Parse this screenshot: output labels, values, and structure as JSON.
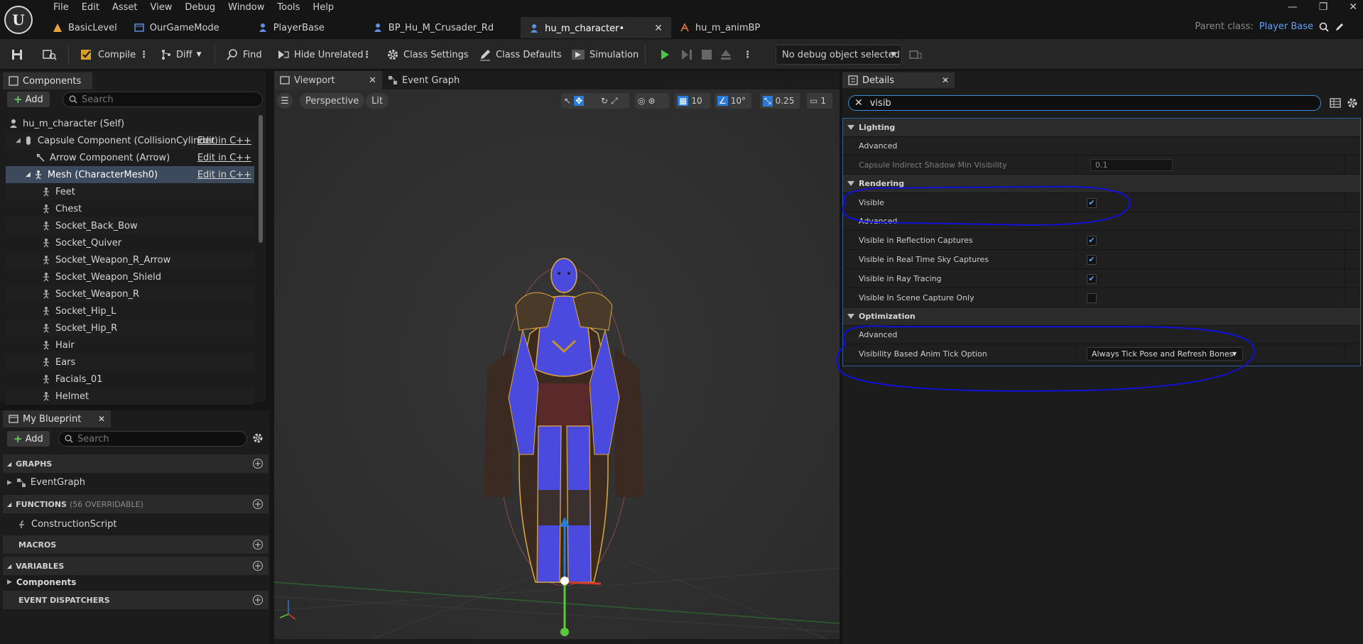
{
  "menu": [
    "File",
    "Edit",
    "Asset",
    "View",
    "Debug",
    "Window",
    "Tools",
    "Help"
  ],
  "doc_tabs": [
    {
      "label": "BasicLevel",
      "color": "#e8a33c"
    },
    {
      "label": "OurGameMode",
      "color": "#5e8fe0"
    },
    {
      "label": "PlayerBase",
      "color": "#5e8fe0"
    },
    {
      "label": "BP_Hu_M_Crusader_Rd",
      "color": "#5e8fe0"
    },
    {
      "label": "hu_m_character•",
      "color": "#5e8fe0"
    },
    {
      "label": "hu_m_animBP",
      "color": "#e07a3c"
    }
  ],
  "active_tab_close": "✕",
  "window_controls": [
    "—",
    "❐",
    "✕"
  ],
  "parent_class": {
    "label": "Parent class:",
    "value": "Player Base"
  },
  "toolbar": {
    "compile": "Compile",
    "diff": "Diff",
    "find": "Find",
    "hide_unrelated": "Hide Unrelated",
    "class_settings": "Class Settings",
    "class_defaults": "Class Defaults",
    "simulation": "Simulation",
    "debug_select": "No debug object selected"
  },
  "components": {
    "tab_label": "Components",
    "add_label": "Add",
    "search_placeholder": "Search",
    "root": "hu_m_character (Self)",
    "rows": [
      {
        "label": "Capsule Component (CollisionCylinder)",
        "edit": "Edit in C++"
      },
      {
        "label": "Arrow Component (Arrow)",
        "edit": "Edit in C++"
      },
      {
        "label": "Mesh (CharacterMesh0)",
        "edit": "Edit in C++"
      }
    ],
    "bones": [
      "Feet",
      "Chest",
      "Socket_Back_Bow",
      "Socket_Quiver",
      "Socket_Weapon_R_Arrow",
      "Socket_Weapon_Shield",
      "Socket_Weapon_R",
      "Socket_Hip_L",
      "Socket_Hip_R",
      "Hair",
      "Ears",
      "Facials_01",
      "Helmet"
    ]
  },
  "my_blueprint": {
    "tab_label": "My Blueprint",
    "add_label": "Add",
    "search_placeholder": "Search",
    "graphs": "GRAPHS",
    "event_graph": "EventGraph",
    "functions": "FUNCTIONS",
    "functions_sub": "(56 OVERRIDABLE)",
    "construction_script": "ConstructionScript",
    "macros": "MACROS",
    "variables": "VARIABLES",
    "components_item": "Components",
    "event_dispatchers": "EVENT DISPATCHERS"
  },
  "viewport": {
    "tab_viewport": "Viewport",
    "tab_event_graph": "Event Graph",
    "perspective": "Perspective",
    "lit": "Lit",
    "grid_size": "10",
    "rot_snap": "10°",
    "scale_snap": "0.25",
    "camera_speed": "1"
  },
  "details": {
    "tab_label": "Details",
    "search_value": "visib",
    "categories": {
      "lighting": "Lighting",
      "advanced": "Advanced",
      "rendering": "Rendering",
      "optimization": "Optimization"
    },
    "props": {
      "capsule_shadow": {
        "label": "Capsule Indirect Shadow Min Visibility",
        "value": "0.1"
      },
      "visible": {
        "label": "Visible",
        "checked": "✔"
      },
      "vis_reflection": {
        "label": "Visible in Reflection Captures",
        "checked": "✔"
      },
      "vis_sky": {
        "label": "Visible in Real Time Sky Captures",
        "checked": "✔"
      },
      "vis_ray": {
        "label": "Visible in Ray Tracing",
        "checked": "✔"
      },
      "vis_scene_capture": {
        "label": "Visible In Scene Capture Only",
        "checked": ""
      },
      "anim_tick": {
        "label": "Visibility Based Anim Tick Option",
        "value": "Always Tick Pose and Refresh Bones"
      }
    }
  },
  "colors": {
    "accent": "#3b8fd8",
    "annotation": "#1010d8",
    "character": "#4a4adf"
  }
}
